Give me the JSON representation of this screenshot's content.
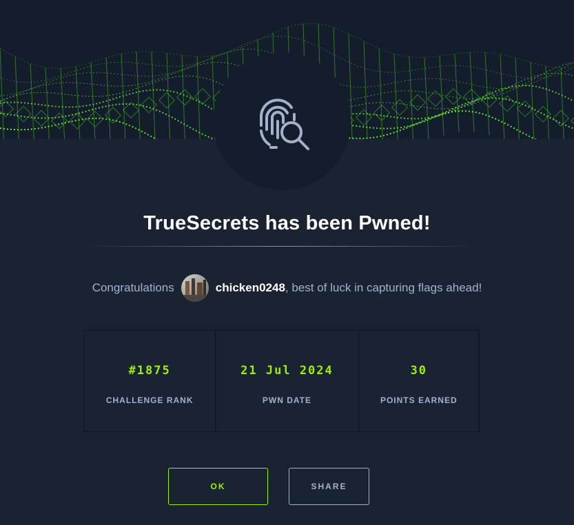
{
  "modal": {
    "title": "TrueSecrets has been Pwned!",
    "icon": "fingerprint-search-icon",
    "banner": "green-wireframe-wave"
  },
  "congrats": {
    "prefix": "Congratulations",
    "username": "chicken0248",
    "suffix": ", best of luck in capturing flags ahead!"
  },
  "stats": [
    {
      "value": "#1875",
      "label": "CHALLENGE RANK"
    },
    {
      "value": "21 Jul 2024",
      "label": "PWN DATE"
    },
    {
      "value": "30",
      "label": "POINTS EARNED"
    }
  ],
  "buttons": {
    "ok": "OK",
    "share": "SHARE"
  },
  "colors": {
    "accent": "#9fef00",
    "background": "#1a2332",
    "panel": "#141d2b",
    "muted_text": "#a4b1cd"
  }
}
